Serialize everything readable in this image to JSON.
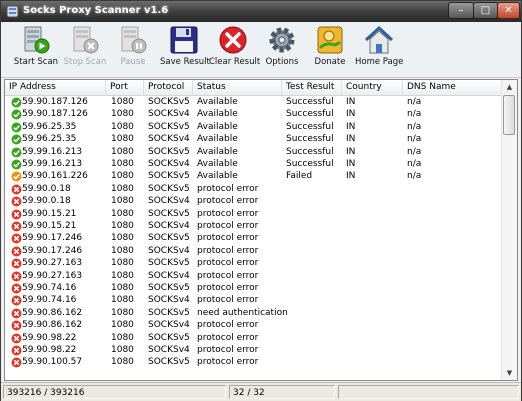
{
  "window": {
    "title": "Socks Proxy Scanner v1.6"
  },
  "toolbar": [
    {
      "id": "start",
      "label": "Start Scan",
      "enabled": true,
      "icon": "start-scan-icon"
    },
    {
      "id": "stop",
      "label": "Stop Scan",
      "enabled": false,
      "icon": "stop-scan-icon"
    },
    {
      "id": "pause",
      "label": "Pause",
      "enabled": false,
      "icon": "pause-icon"
    },
    {
      "id": "save",
      "label": "Save Result",
      "enabled": true,
      "icon": "floppy-disk-icon"
    },
    {
      "id": "clear",
      "label": "Clear Result",
      "enabled": true,
      "icon": "red-x-icon"
    },
    {
      "id": "options",
      "label": "Options",
      "enabled": true,
      "icon": "gear-icon"
    },
    {
      "id": "donate",
      "label": "Donate",
      "enabled": true,
      "icon": "hand-coin-icon"
    },
    {
      "id": "home",
      "label": "Home Page",
      "enabled": true,
      "icon": "house-icon"
    }
  ],
  "columns": [
    "IP Address",
    "Port",
    "Protocol",
    "Status",
    "Test Result",
    "Country",
    "DNS Name"
  ],
  "rows": [
    {
      "status_icon": "success",
      "ip": "59.90.187.126",
      "port": "1080",
      "protocol": "SOCKSv5",
      "status": "Available",
      "test": "Successful",
      "country": "IN",
      "dns": "n/a"
    },
    {
      "status_icon": "success",
      "ip": "59.90.187.126",
      "port": "1080",
      "protocol": "SOCKSv4",
      "status": "Available",
      "test": "Successful",
      "country": "IN",
      "dns": "n/a"
    },
    {
      "status_icon": "success",
      "ip": "59.96.25.35",
      "port": "1080",
      "protocol": "SOCKSv5",
      "status": "Available",
      "test": "Successful",
      "country": "IN",
      "dns": "n/a"
    },
    {
      "status_icon": "success",
      "ip": "59.96.25.35",
      "port": "1080",
      "protocol": "SOCKSv4",
      "status": "Available",
      "test": "Successful",
      "country": "IN",
      "dns": "n/a"
    },
    {
      "status_icon": "success",
      "ip": "59.99.16.213",
      "port": "1080",
      "protocol": "SOCKSv5",
      "status": "Available",
      "test": "Successful",
      "country": "IN",
      "dns": "n/a"
    },
    {
      "status_icon": "success",
      "ip": "59.99.16.213",
      "port": "1080",
      "protocol": "SOCKSv4",
      "status": "Available",
      "test": "Successful",
      "country": "IN",
      "dns": "n/a"
    },
    {
      "status_icon": "warning",
      "ip": "59.90.161.226",
      "port": "1080",
      "protocol": "SOCKSv5",
      "status": "Available",
      "test": "Failed",
      "country": "IN",
      "dns": "n/a"
    },
    {
      "status_icon": "error",
      "ip": "59.90.0.18",
      "port": "1080",
      "protocol": "SOCKSv5",
      "status": "protocol error",
      "test": "",
      "country": "",
      "dns": ""
    },
    {
      "status_icon": "error",
      "ip": "59.90.0.18",
      "port": "1080",
      "protocol": "SOCKSv4",
      "status": "protocol error",
      "test": "",
      "country": "",
      "dns": ""
    },
    {
      "status_icon": "error",
      "ip": "59.90.15.21",
      "port": "1080",
      "protocol": "SOCKSv5",
      "status": "protocol error",
      "test": "",
      "country": "",
      "dns": ""
    },
    {
      "status_icon": "error",
      "ip": "59.90.15.21",
      "port": "1080",
      "protocol": "SOCKSv4",
      "status": "protocol error",
      "test": "",
      "country": "",
      "dns": ""
    },
    {
      "status_icon": "error",
      "ip": "59.90.17.246",
      "port": "1080",
      "protocol": "SOCKSv5",
      "status": "protocol error",
      "test": "",
      "country": "",
      "dns": ""
    },
    {
      "status_icon": "error",
      "ip": "59.90.17.246",
      "port": "1080",
      "protocol": "SOCKSv4",
      "status": "protocol error",
      "test": "",
      "country": "",
      "dns": ""
    },
    {
      "status_icon": "error",
      "ip": "59.90.27.163",
      "port": "1080",
      "protocol": "SOCKSv5",
      "status": "protocol error",
      "test": "",
      "country": "",
      "dns": ""
    },
    {
      "status_icon": "error",
      "ip": "59.90.27.163",
      "port": "1080",
      "protocol": "SOCKSv4",
      "status": "protocol error",
      "test": "",
      "country": "",
      "dns": ""
    },
    {
      "status_icon": "error",
      "ip": "59.90.74.16",
      "port": "1080",
      "protocol": "SOCKSv5",
      "status": "protocol error",
      "test": "",
      "country": "",
      "dns": ""
    },
    {
      "status_icon": "error",
      "ip": "59.90.74.16",
      "port": "1080",
      "protocol": "SOCKSv4",
      "status": "protocol error",
      "test": "",
      "country": "",
      "dns": ""
    },
    {
      "status_icon": "error",
      "ip": "59.90.86.162",
      "port": "1080",
      "protocol": "SOCKSv5",
      "status": "need authentication",
      "test": "",
      "country": "",
      "dns": ""
    },
    {
      "status_icon": "error",
      "ip": "59.90.86.162",
      "port": "1080",
      "protocol": "SOCKSv4",
      "status": "protocol error",
      "test": "",
      "country": "",
      "dns": ""
    },
    {
      "status_icon": "error",
      "ip": "59.90.98.22",
      "port": "1080",
      "protocol": "SOCKSv5",
      "status": "protocol error",
      "test": "",
      "country": "",
      "dns": ""
    },
    {
      "status_icon": "error",
      "ip": "59.90.98.22",
      "port": "1080",
      "protocol": "SOCKSv4",
      "status": "protocol error",
      "test": "",
      "country": "",
      "dns": ""
    },
    {
      "status_icon": "error",
      "ip": "59.90.100.57",
      "port": "1080",
      "protocol": "SOCKSv5",
      "status": "protocol error",
      "test": "",
      "country": "",
      "dns": ""
    }
  ],
  "statusbar": {
    "left": "393216 / 393216",
    "middle": "32 / 32"
  },
  "colors": {
    "success": "#3aa41e",
    "warning": "#e0961c",
    "error": "#d93a2e"
  }
}
